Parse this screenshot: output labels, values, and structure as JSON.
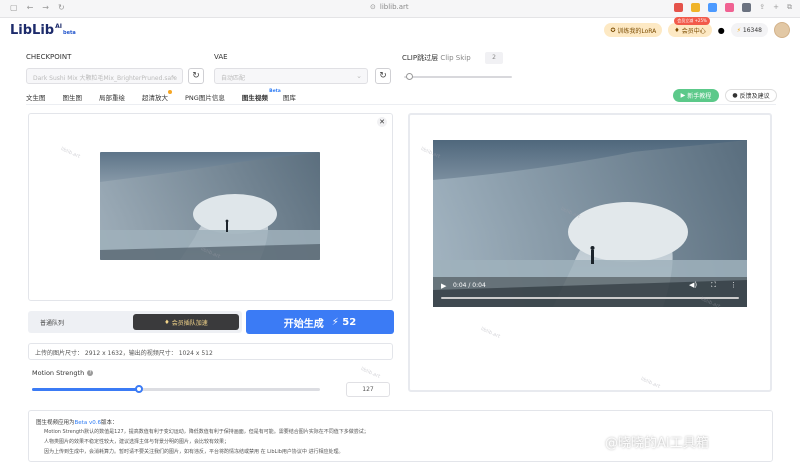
{
  "browser": {
    "url": "liblib.art",
    "extension_colors": [
      "#e5534b",
      "#f0b429",
      "#4c9aff",
      "#f06292",
      "#6b7280"
    ]
  },
  "header": {
    "logo_text": "LibLib",
    "logo_ai": "AI",
    "logo_beta": "beta",
    "lora_button": "训练我的LoRA",
    "member_badge": "会员立减 +25%",
    "member_button": "会员中心",
    "credits": "16348"
  },
  "model_panel": {
    "checkpoint_label": "CHECKPOINT",
    "checkpoint_value": "Dark Sushi Mix 大颗粒毛Mix_BrighterPruned.safe",
    "vae_label": "VAE",
    "vae_value": "自动匹配",
    "clip_label": "CLIP跳过层",
    "clip_label_en": "Clip Skip",
    "clip_value": "2"
  },
  "tabs": [
    {
      "label": "文生图"
    },
    {
      "label": "图生图"
    },
    {
      "label": "局部重绘"
    },
    {
      "label": "超清放大"
    },
    {
      "label": "PNG图片信息"
    },
    {
      "label": "图生视频",
      "beta": "Beta"
    },
    {
      "label": "图库"
    }
  ],
  "actions": {
    "newbie_tutorial": "新手教程",
    "feedback": "反馈及建议"
  },
  "queue": {
    "normal": "普通队列",
    "vip": "会员插队加速",
    "generate": "开始生成",
    "cost": "52"
  },
  "size_info": {
    "text": "上传的图片尺寸： 2912 x 1632，输出的视频尺寸： 1024 x 512"
  },
  "motion": {
    "label": "Motion Strength",
    "value": "127",
    "fraction": 0.5
  },
  "video": {
    "time": "0:04 / 0:04"
  },
  "notes": {
    "title_prefix": "图生视频应用为",
    "title_link": "Beta v0.6",
    "title_suffix": "版本：",
    "lines": [
      "Motion Strength默认的数值是127，提高数值有利于变幻运动，降低数值有利于保持画面，但是有可能。需要结合图片实际在不同值下多做尝试；",
      "人物类图片的效果不稳定性较大，建议选择主体与背景分明的图片，会比较有效果；",
      "因为上传到生成中，会消耗算力。暂时请不要关注我们的图片，如有违反，平台将酌情冻结或禁用 在 LibLib用户协议中 进行相应处理。"
    ]
  },
  "watermarks": {
    "site": "liblib.art",
    "weibo": "@晓晓的AI工具箱"
  }
}
